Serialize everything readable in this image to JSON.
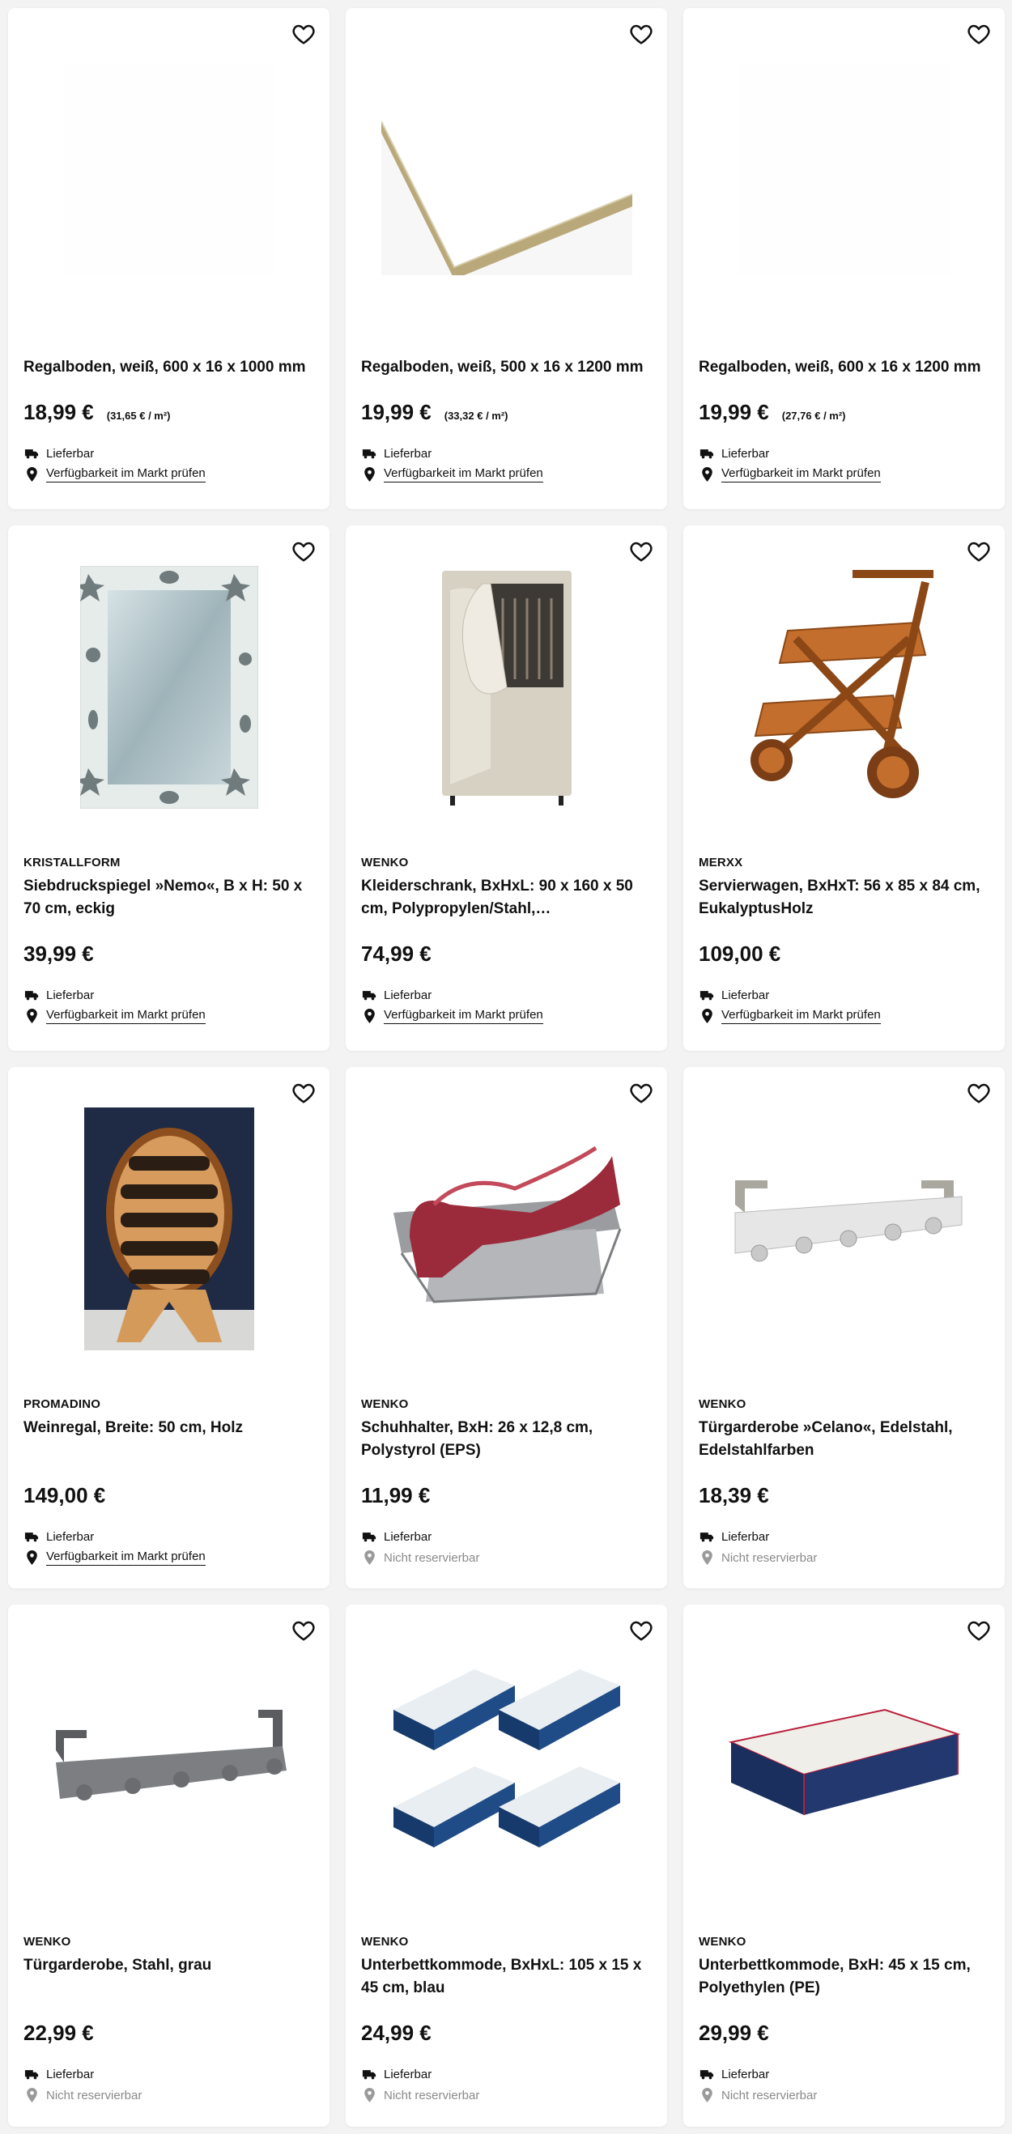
{
  "products": [
    {
      "brand": "",
      "title": "Regalboden, weiß, 600 x 16 x 1000 mm",
      "price": "18,99 €",
      "unit_price": "(31,65 € / m²)",
      "delivery": "Lieferbar",
      "availability": "Verfügbarkeit im Markt prüfen",
      "availability_type": "link",
      "image": "white-shelf-blank"
    },
    {
      "brand": "",
      "title": "Regalboden, weiß, 500 x 16 x 1200 mm",
      "price": "19,99 €",
      "unit_price": "(33,32 € / m²)",
      "delivery": "Lieferbar",
      "availability": "Verfügbarkeit im Markt prüfen",
      "availability_type": "link",
      "image": "white-shelf-board"
    },
    {
      "brand": "",
      "title": "Regalboden, weiß, 600 x 16 x 1200 mm",
      "price": "19,99 €",
      "unit_price": "(27,76 € / m²)",
      "delivery": "Lieferbar",
      "availability": "Verfügbarkeit im Markt prüfen",
      "availability_type": "link",
      "image": "white-shelf-blank"
    },
    {
      "brand": "KRISTALLFORM",
      "title": "Siebdruckspiegel »Nemo«, B x H: 50 x 70 cm, eckig",
      "price": "39,99 €",
      "unit_price": "",
      "delivery": "Lieferbar",
      "availability": "Verfügbarkeit im Markt prüfen",
      "availability_type": "link",
      "image": "mirror"
    },
    {
      "brand": "WENKO",
      "title": "Kleiderschrank, BxHxL: 90 x 160 x 50 cm, Polypropylen/Stahl,…",
      "price": "74,99 €",
      "unit_price": "",
      "delivery": "Lieferbar",
      "availability": "Verfügbarkeit im Markt prüfen",
      "availability_type": "link",
      "image": "wardrobe"
    },
    {
      "brand": "MERXX",
      "title": "Servierwagen, BxHxT: 56 x 85 x 84 cm, EukalyptusHolz",
      "price": "109,00 €",
      "unit_price": "",
      "delivery": "Lieferbar",
      "availability": "Verfügbarkeit im Markt prüfen",
      "availability_type": "link",
      "image": "serving-cart"
    },
    {
      "brand": "PROMADINO",
      "title": "Weinregal, Breite: 50 cm, Holz",
      "price": "149,00 €",
      "unit_price": "",
      "delivery": "Lieferbar",
      "availability": "Verfügbarkeit im Markt prüfen",
      "availability_type": "link",
      "image": "wine-rack"
    },
    {
      "brand": "WENKO",
      "title": "Schuhhalter, BxH: 26 x 12,8 cm, Polystyrol (EPS)",
      "price": "11,99 €",
      "unit_price": "",
      "delivery": "Lieferbar",
      "availability": "Nicht reservierbar",
      "availability_type": "muted",
      "image": "shoe-holder"
    },
    {
      "brand": "WENKO",
      "title": "Türgarderobe »Celano«, Edelstahl, Edelstahlfarben",
      "price": "18,39 €",
      "unit_price": "",
      "delivery": "Lieferbar",
      "availability": "Nicht reservierbar",
      "availability_type": "muted",
      "image": "door-hook-silver"
    },
    {
      "brand": "WENKO",
      "title": "Türgarderobe, Stahl, grau",
      "price": "22,99 €",
      "unit_price": "",
      "delivery": "Lieferbar",
      "availability": "Nicht reservierbar",
      "availability_type": "muted",
      "image": "door-hook-grey"
    },
    {
      "brand": "WENKO",
      "title": "Unterbettkommode, BxHxL: 105 x 15 x 45 cm, blau",
      "price": "24,99 €",
      "unit_price": "",
      "delivery": "Lieferbar",
      "availability": "Nicht reservierbar",
      "availability_type": "muted",
      "image": "underbed-boxes-4"
    },
    {
      "brand": "WENKO",
      "title": "Unterbettkommode, BxH: 45 x 15 cm, Polyethylen (PE)",
      "price": "29,99 €",
      "unit_price": "",
      "delivery": "Lieferbar",
      "availability": "Nicht reservierbar",
      "availability_type": "muted",
      "image": "underbed-box-1"
    }
  ],
  "icons": {
    "favorite": "heart-icon",
    "delivery": "truck-icon",
    "availability_link": "location-pin-icon",
    "availability_muted": "location-pin-grey-icon"
  },
  "colors": {
    "text": "#111111",
    "muted": "#8a8a8a",
    "background": "#f3f3f3",
    "card": "#ffffff"
  }
}
